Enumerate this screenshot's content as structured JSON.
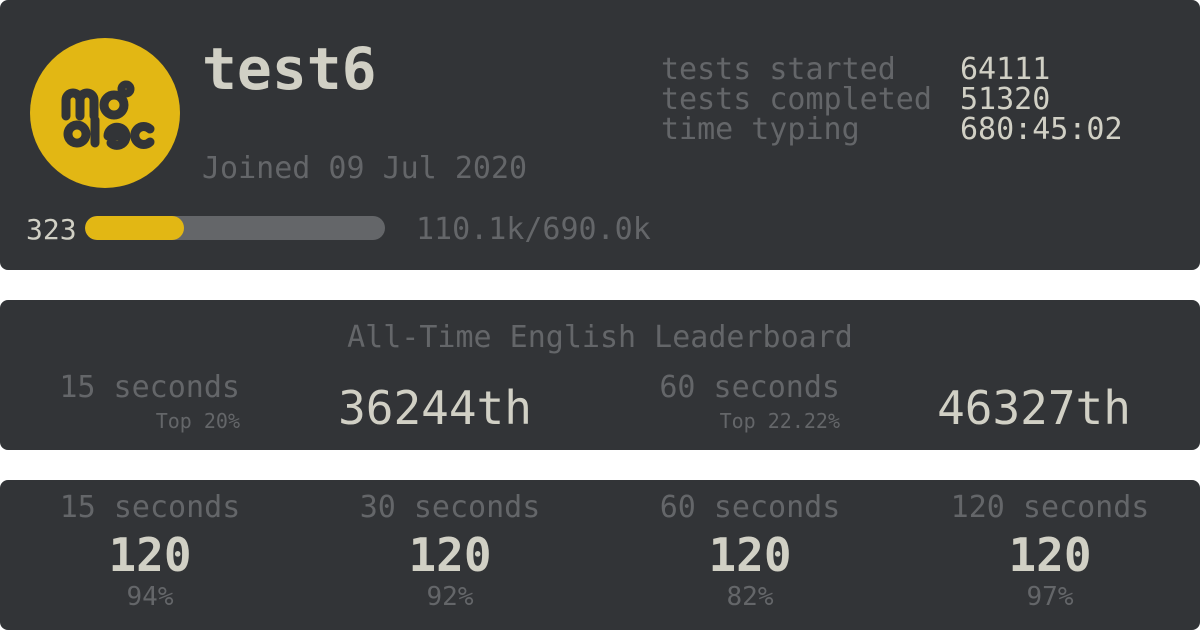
{
  "profile": {
    "username": "test6",
    "joined": "Joined 09 Jul 2020",
    "level": "323",
    "xp": "110.1k/690.0k",
    "xp_progress": 0.33,
    "avatar": {
      "logo": "monkeytype-logo",
      "color": "#e2b714"
    },
    "stats": {
      "tests_started_label": "tests started",
      "tests_started_value": "64111",
      "tests_completed_label": "tests completed",
      "tests_completed_value": "51320",
      "time_typing_label": "time typing",
      "time_typing_value": "680:45:02"
    }
  },
  "leaderboard": {
    "title": "All-Time English Leaderboard",
    "entries": [
      {
        "label": "15 seconds",
        "top": "Top 20%",
        "rank": "36244th"
      },
      {
        "label": "60 seconds",
        "top": "Top 22.22%",
        "rank": "46327th"
      }
    ]
  },
  "personal_bests": [
    {
      "label": "15 seconds",
      "wpm": "120",
      "acc": "94%"
    },
    {
      "label": "30 seconds",
      "wpm": "120",
      "acc": "92%"
    },
    {
      "label": "60 seconds",
      "wpm": "120",
      "acc": "82%"
    },
    {
      "label": "120 seconds",
      "wpm": "120",
      "acc": "97%"
    }
  ],
  "colors": {
    "background": "#323437",
    "main": "#e2b714",
    "text": "#d1d0c5",
    "sub": "#646669"
  }
}
